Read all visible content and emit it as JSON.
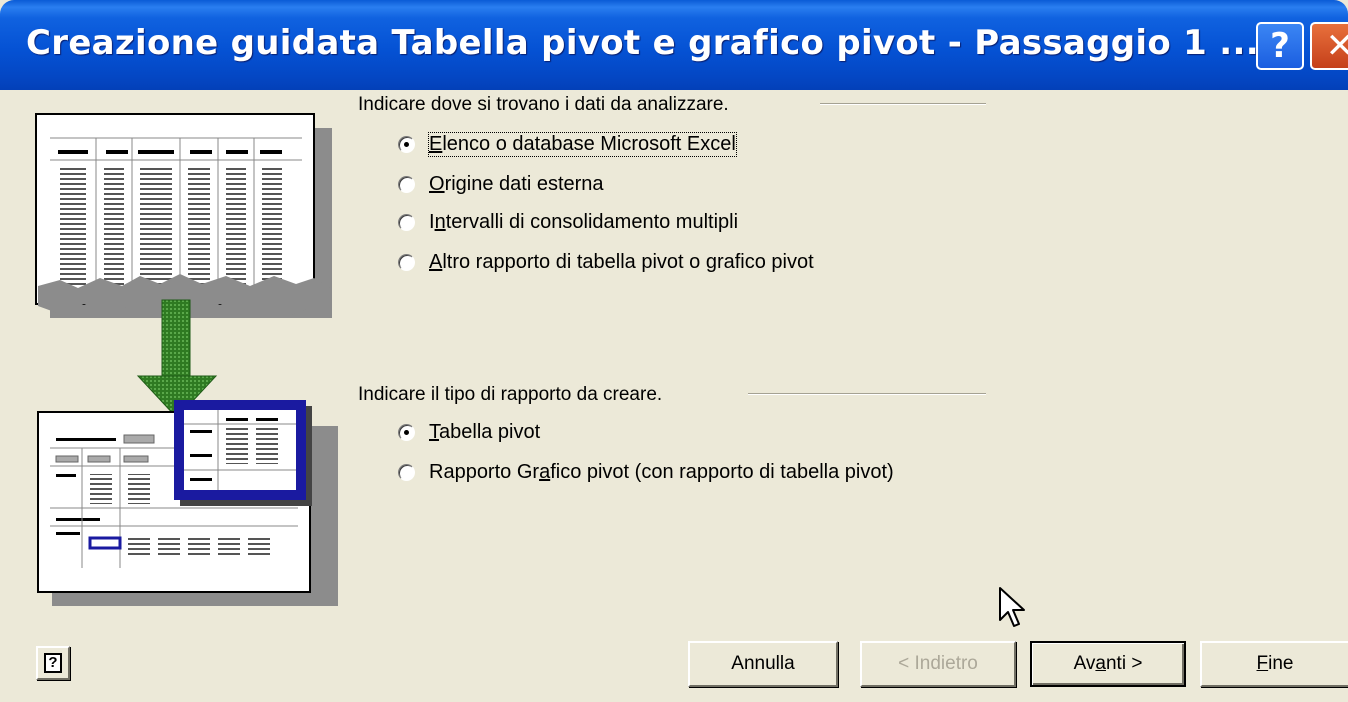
{
  "window": {
    "title": "Creazione guidata Tabella pivot e grafico pivot - Passaggio 1 ...",
    "help_glyph": "?",
    "close_glyph": "✕"
  },
  "source_group": {
    "label": "Indicare dove si trovano i dati da analizzare.",
    "options": [
      {
        "prefix": "",
        "key": "E",
        "rest": "lenco o database Microsoft Excel",
        "checked": true
      },
      {
        "prefix": "",
        "key": "O",
        "rest": "rigine dati esterna",
        "checked": false
      },
      {
        "prefix": "I",
        "key": "n",
        "rest": "tervalli di consolidamento multipli",
        "checked": false
      },
      {
        "prefix": "",
        "key": "A",
        "rest": "ltro rapporto di  tabella pivot o grafico pivot",
        "checked": false
      }
    ]
  },
  "report_group": {
    "label": "Indicare il tipo di rapporto da creare.",
    "options": [
      {
        "prefix": "",
        "key": "T",
        "rest": "abella pivot",
        "checked": true
      },
      {
        "prefix": "Rapporto Gr",
        "key": "a",
        "rest": "fico pivot (con rapporto di tabella pivot)",
        "checked": false
      }
    ]
  },
  "buttons": {
    "cancel": "Annulla",
    "back": "< Indietro",
    "next_prefix": "Av",
    "next_key": "a",
    "next_rest": "nti >",
    "finish_key": "F",
    "finish_rest": "ine",
    "help": "?"
  },
  "colors": {
    "titlebar": "#0552d4",
    "dialog_bg": "#ece9d8",
    "arrow_green": "#3a8a2a",
    "highlight_blue": "#1a1aa0"
  }
}
